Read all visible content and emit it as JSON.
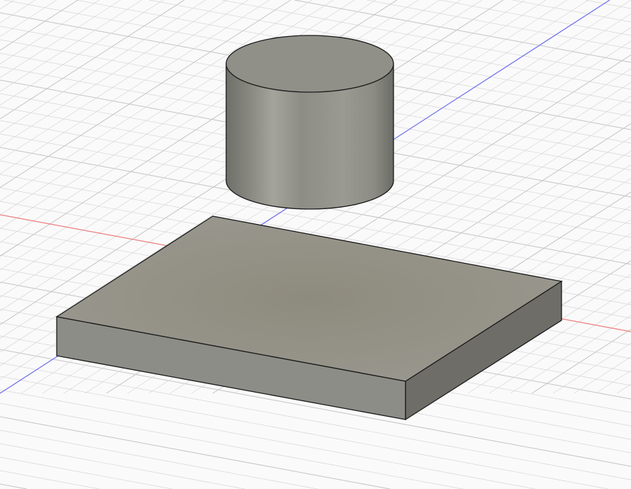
{
  "viewport": {
    "background": "#fafafa",
    "grid_color": "#d6d6d6",
    "grid_major_color": "#c4c4c4",
    "x_axis_color": "#f08080",
    "y_axis_color": "#7070ee"
  },
  "bodies": {
    "cylinder_color": "#8f8f87",
    "box_top_color": "#94928a",
    "box_front_color": "#8d8d87",
    "box_side_color": "#6e6d68",
    "edge_color": "#1a1a1a"
  }
}
